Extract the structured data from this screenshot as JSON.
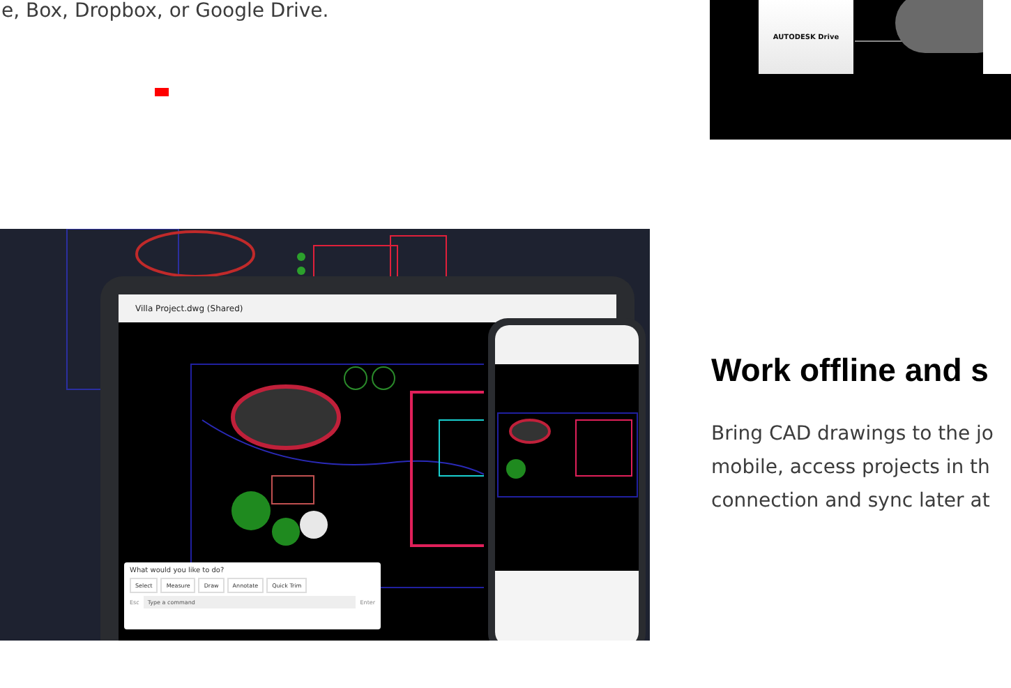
{
  "intro_text": "e, Box, Dropbox, or Google Drive.",
  "storage_image": {
    "card_label": "AUTODESK Drive"
  },
  "devices_image": {
    "tablet": {
      "file_title": "Villa Project.dwg (Shared)",
      "command_prompt": "What would you like to do?",
      "tools": [
        "Select",
        "Measure",
        "Draw",
        "Annotate",
        "Quick Trim"
      ],
      "esc": "Esc",
      "command_placeholder": "Type a command",
      "enter": "Enter"
    }
  },
  "feature": {
    "heading": "Work offline and s",
    "lines": [
      "Bring CAD drawings to the jo",
      "mobile, access projects in th",
      "connection and sync later at"
    ]
  }
}
